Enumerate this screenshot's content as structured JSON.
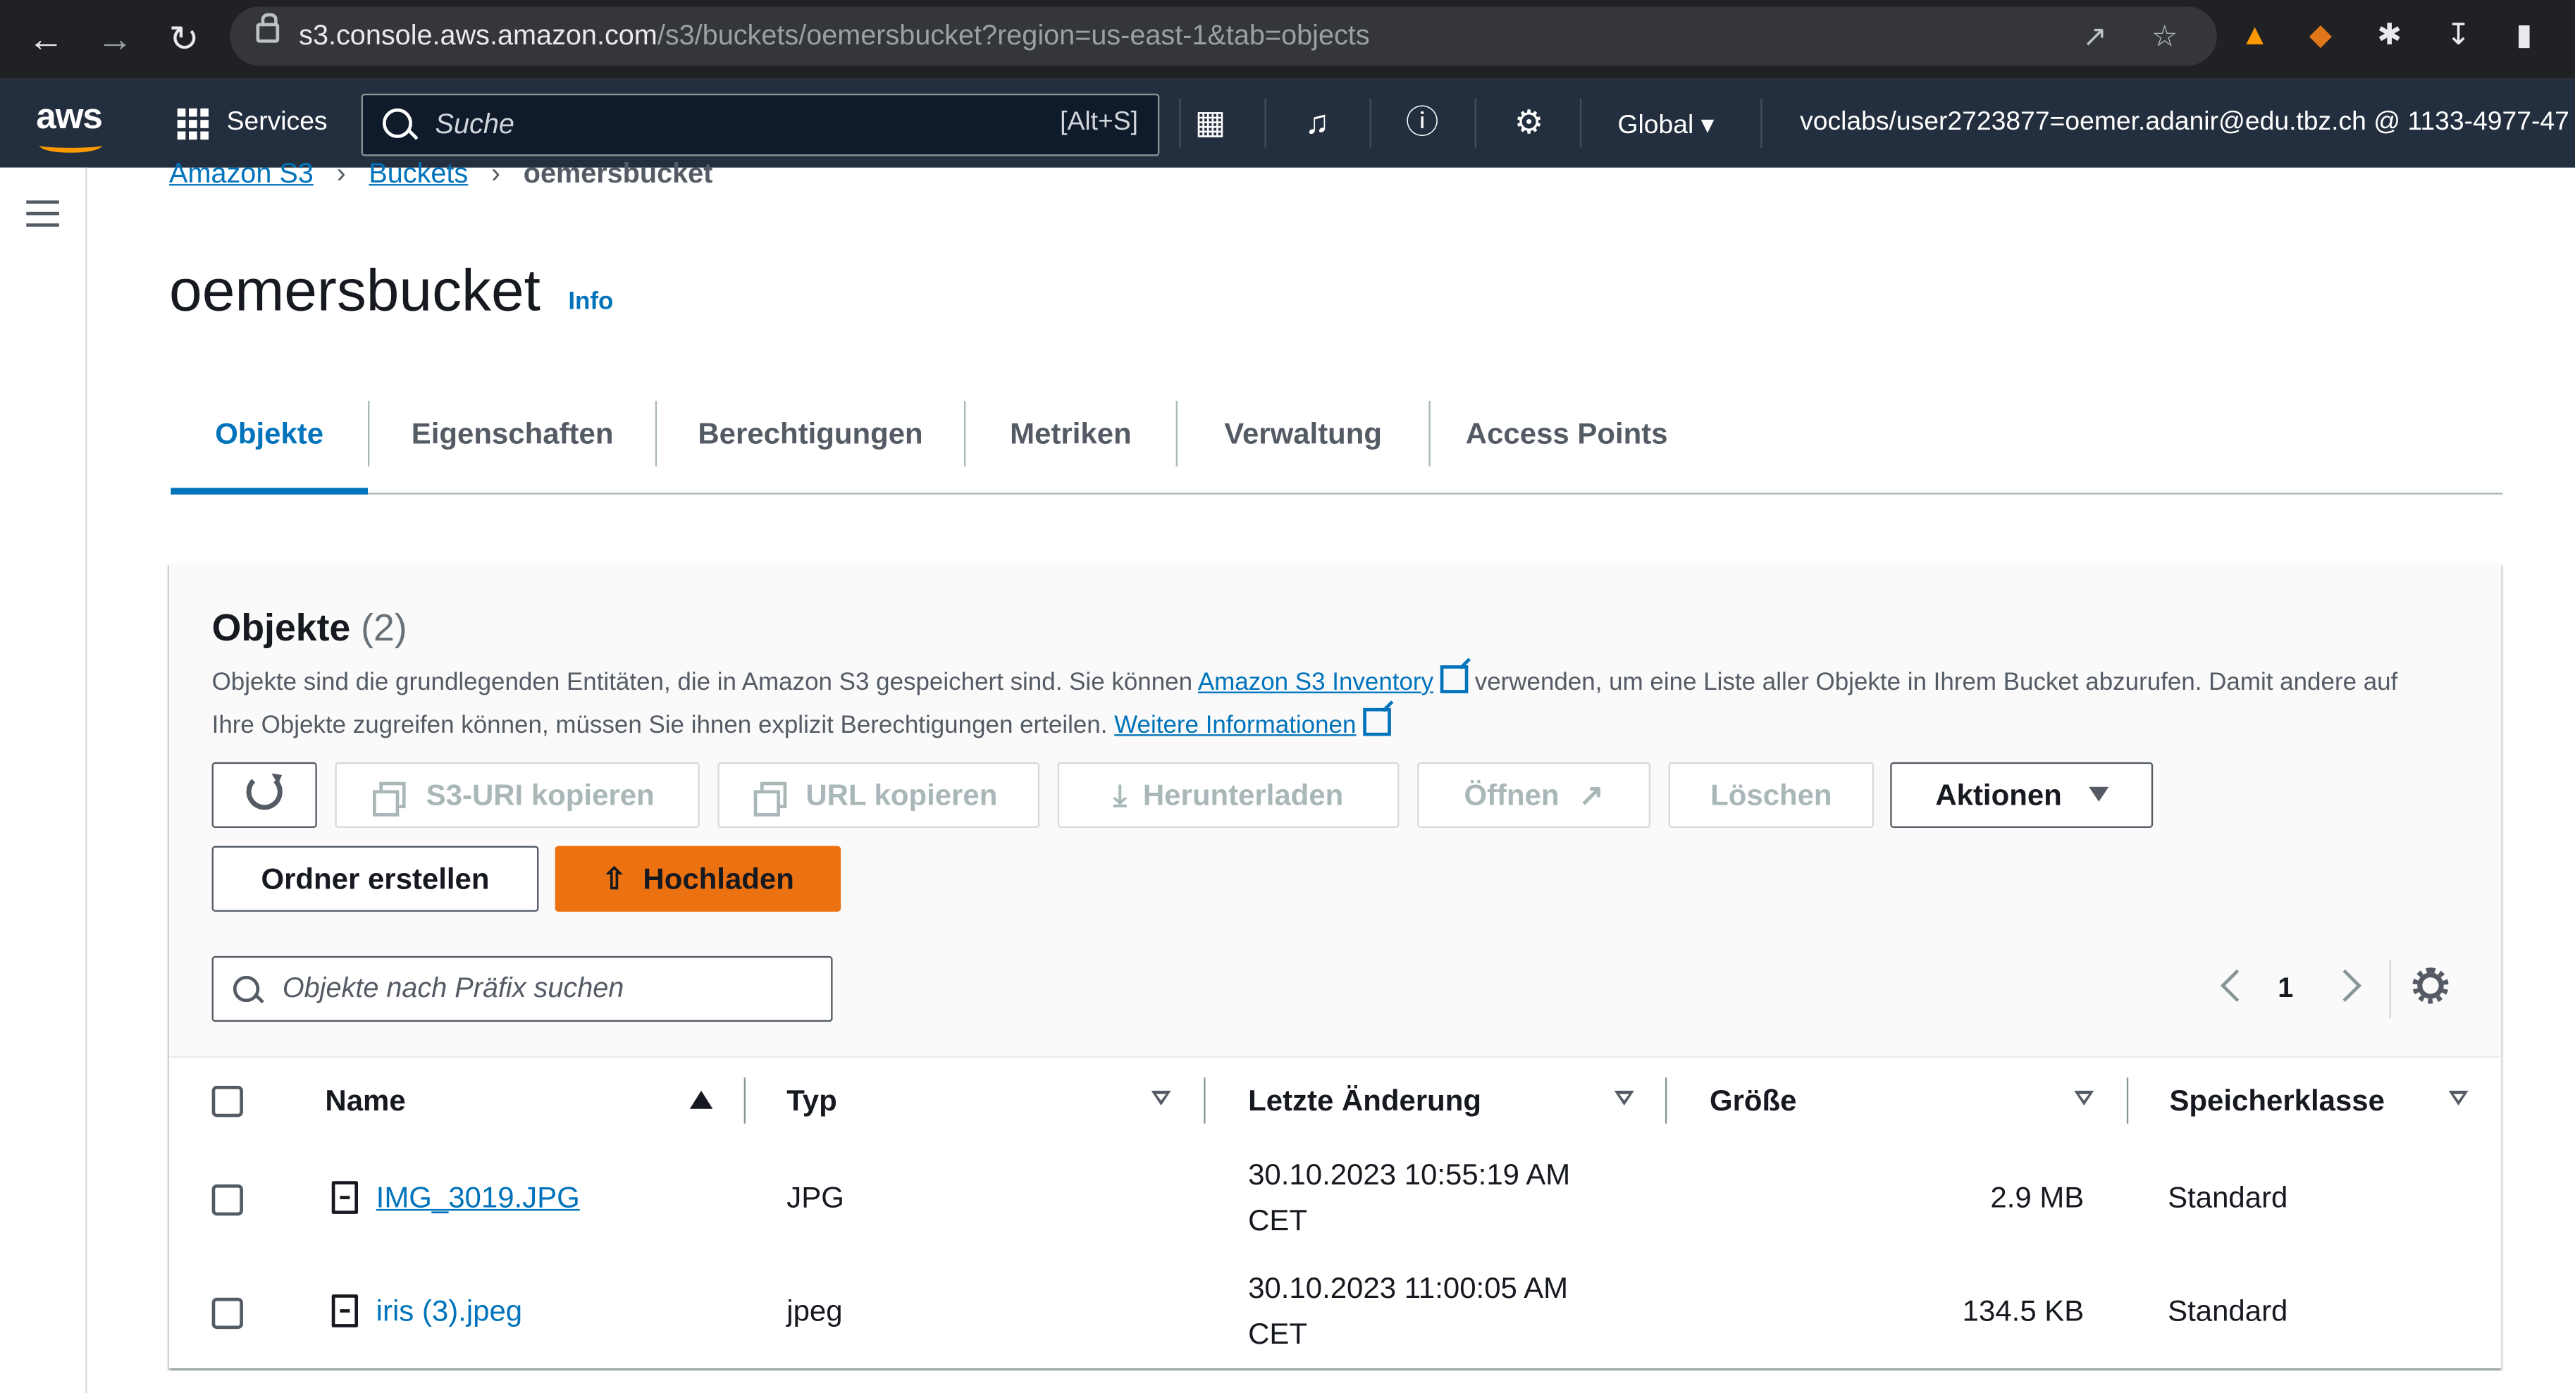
{
  "browser": {
    "url_host": "s3.console.aws.amazon.com",
    "url_path": "/s3/buckets/oemersbucket?region=us-east-1&tab=objects"
  },
  "awsnav": {
    "logo": "aws",
    "services": "Services",
    "search_placeholder": "Suche",
    "search_shortcut": "[Alt+S]",
    "region": "Global",
    "account": "voclabs/user2723877=oemer.adanir@edu.tbz.ch @ 1133-4977-47"
  },
  "breadcrumb": {
    "items": [
      "Amazon S3",
      "Buckets"
    ],
    "current": "oemersbucket"
  },
  "page": {
    "title": "oemersbucket",
    "info": "Info"
  },
  "tabs": [
    {
      "label": "Objekte",
      "active": true
    },
    {
      "label": "Eigenschaften"
    },
    {
      "label": "Berechtigungen"
    },
    {
      "label": "Metriken"
    },
    {
      "label": "Verwaltung"
    },
    {
      "label": "Access Points"
    }
  ],
  "objects": {
    "title": "Objekte",
    "count": "(2)",
    "desc_1": "Objekte sind die grundlegenden Entitäten, die in Amazon S3 gespeichert sind. Sie können ",
    "desc_link_1": "Amazon S3 Inventory",
    "desc_2": " verwenden, um eine Liste aller Objekte in Ihrem Bucket abzurufen. Damit andere auf Ihre Objekte zugreifen können, müssen Sie ihnen explizit Berechtigungen erteilen. ",
    "desc_link_2": "Weitere Informationen"
  },
  "toolbar": {
    "copy_s3_uri": "S3-URI kopieren",
    "copy_url": "URL kopieren",
    "download": "Herunterladen",
    "open": "Öffnen",
    "delete": "Löschen",
    "actions": "Aktionen",
    "create_folder": "Ordner erstellen",
    "upload": "Hochladen"
  },
  "filter": {
    "placeholder": "Objekte nach Präfix suchen"
  },
  "pagination": {
    "page": "1"
  },
  "table": {
    "columns": [
      "Name",
      "Typ",
      "Letzte Änderung",
      "Größe",
      "Speicherklasse"
    ],
    "rows": [
      {
        "name": "IMG_3019.JPG",
        "type": "JPG",
        "modified_1": "30.10.2023 10:55:19 AM",
        "modified_2": "CET",
        "size": "2.9 MB",
        "class": "Standard"
      },
      {
        "name": "iris (3).jpeg",
        "type": "jpeg",
        "modified_1": "30.10.2023 11:00:05 AM",
        "modified_2": "CET",
        "size": "134.5 KB",
        "class": "Standard"
      }
    ]
  },
  "colors": {
    "aws_nav": "#232f3e",
    "link": "#0073bb",
    "primary": "#ec7211"
  }
}
